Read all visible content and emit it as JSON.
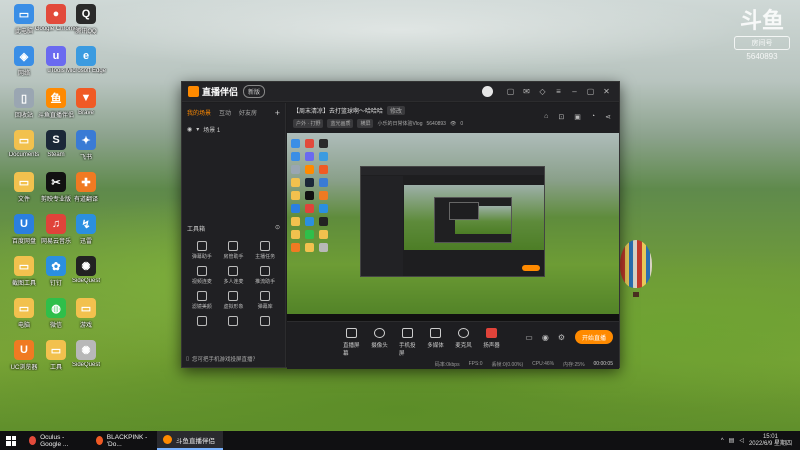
{
  "desktop": {
    "icons": [
      {
        "label": "此电脑",
        "color": "#3a8ee6",
        "glyph": "▭"
      },
      {
        "label": "Google Chrome",
        "color": "#e24a3b",
        "glyph": "●"
      },
      {
        "label": "腾讯QQ",
        "color": "#2a2a2a",
        "glyph": "Q"
      },
      {
        "label": "网络",
        "color": "#3a8ee6",
        "glyph": "◈"
      },
      {
        "label": "uTools",
        "color": "#6a6af0",
        "glyph": "u"
      },
      {
        "label": "Microsoft Edge",
        "color": "#3b9be0",
        "glyph": "e"
      },
      {
        "label": "回收站",
        "color": "#9aa6b2",
        "glyph": "▯"
      },
      {
        "label": "斗鱼直播伴侣",
        "color": "#ff8a00",
        "glyph": "鱼"
      },
      {
        "label": "Brave",
        "color": "#f05a24",
        "glyph": "▼"
      },
      {
        "label": "Documents",
        "color": "#f2c14e",
        "glyph": "▭"
      },
      {
        "label": "Steam",
        "color": "#1b2838",
        "glyph": "S"
      },
      {
        "label": "飞书",
        "color": "#3a7bd5",
        "glyph": "✦"
      },
      {
        "label": "文件",
        "color": "#f2c14e",
        "glyph": "▭"
      },
      {
        "label": "剪映专业版",
        "color": "#111111",
        "glyph": "✂"
      },
      {
        "label": "有道翻译",
        "color": "#f07a22",
        "glyph": "✚"
      },
      {
        "label": "百度网盘",
        "color": "#2b7fe0",
        "glyph": "U"
      },
      {
        "label": "网易云音乐",
        "color": "#e0433a",
        "glyph": "♫"
      },
      {
        "label": "迅雷",
        "color": "#2b8fe0",
        "glyph": "↯"
      },
      {
        "label": "截图工具",
        "color": "#f2c14e",
        "glyph": "▭"
      },
      {
        "label": "钉钉",
        "color": "#2b8fe0",
        "glyph": "✿"
      },
      {
        "label": "SideQuest",
        "color": "#222222",
        "glyph": "✺"
      },
      {
        "label": "电脑",
        "color": "#f2c14e",
        "glyph": "▭"
      },
      {
        "label": "微信",
        "color": "#2fbf4a",
        "glyph": "◍"
      },
      {
        "label": "游戏",
        "color": "#f2c14e",
        "glyph": "▭"
      },
      {
        "label": "UC浏览器",
        "color": "#f07a22",
        "glyph": "U"
      },
      {
        "label": "工具",
        "color": "#f2c14e",
        "glyph": "▭"
      },
      {
        "label": "SideQuest",
        "color": "#b8b8b8",
        "glyph": "✺"
      }
    ]
  },
  "watermark": {
    "logo": "斗鱼",
    "room_label": "房间号",
    "room_number": "5640893"
  },
  "app": {
    "title": "直播伴侣",
    "version_badge": "新版",
    "sidebar": {
      "tabs": [
        "我的场景",
        "互动",
        "好友房"
      ],
      "add": "+",
      "scene_name": "场景 1",
      "tools_heading": "工具箱",
      "tools": [
        "弹幕助手",
        "房管助手",
        "主播任务",
        "视频连麦",
        "多人连麦",
        "推流助手",
        "滤镜美颜",
        "虚拟形象",
        "弹幕库",
        "",
        "",
        ""
      ],
      "footer": "您可把手机游戏投屏直播？"
    },
    "room": {
      "title": "【周末清凉】去打篮球啊～哈哈哈",
      "edit": "修改",
      "category": "户外 · 打野",
      "quality": "蓝光画质",
      "mode": "横屏",
      "address": "小乐的日常体验Vlog",
      "id": "5640893",
      "viewers": "0"
    },
    "controls": [
      {
        "label": "直播屏幕",
        "shape": "rect"
      },
      {
        "label": "摄像头",
        "shape": "round"
      },
      {
        "label": "手机投屏",
        "shape": "rect"
      },
      {
        "label": "多媒体",
        "shape": "rect"
      },
      {
        "label": "麦克风",
        "shape": "round"
      },
      {
        "label": "扬声器",
        "shape": "red"
      }
    ],
    "go_live": "开始直播",
    "status": {
      "rate": "码率:0kbps",
      "fps": "FPS:0",
      "drop": "丢帧:0(0.00%)",
      "cpu": "CPU:46%",
      "mem": "内存:25%",
      "timer": "00:00:05"
    }
  },
  "taskbar": {
    "tasks": [
      {
        "label": "Oculus - Google ...",
        "color": "#e24a3b"
      },
      {
        "label": "BLACKPINK - 'Do...",
        "color": "#f05a24"
      },
      {
        "label": "斗鱼直播伴侣",
        "color": "#ff8a00"
      }
    ],
    "time": "15:01",
    "date": "2022/6/9 星期四"
  }
}
